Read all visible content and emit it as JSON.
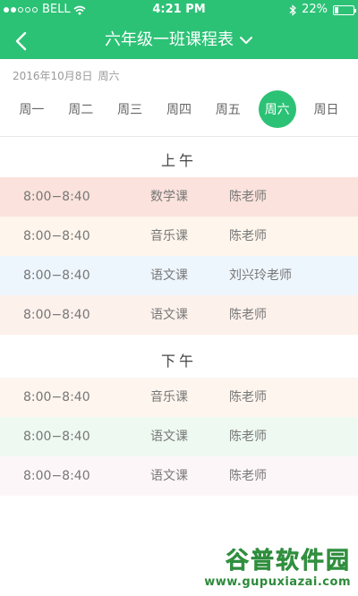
{
  "status": {
    "carrier": "BELL",
    "time": "4:21 PM",
    "battery": "22%",
    "battery_level": 0.22
  },
  "nav": {
    "title": "六年级一班课程表"
  },
  "date": {
    "date_text": "2016年10月8日",
    "weekday_text": "周六"
  },
  "week": {
    "days": [
      "周一",
      "周二",
      "周三",
      "周四",
      "周五",
      "周六",
      "周日"
    ],
    "selected": "周六"
  },
  "morning": {
    "title": "上午",
    "rows": [
      {
        "time": "8:00−8:40",
        "course": "数学课",
        "teacher": "陈老师",
        "bg": "#fbe2dc"
      },
      {
        "time": "8:00−8:40",
        "course": "音乐课",
        "teacher": "陈老师",
        "bg": "#fef5ec"
      },
      {
        "time": "8:00−8:40",
        "course": "语文课",
        "teacher": "刘兴玲老师",
        "bg": "#eef6fd"
      },
      {
        "time": "8:00−8:40",
        "course": "语文课",
        "teacher": "陈老师",
        "bg": "#fdf1ec"
      }
    ]
  },
  "afternoon": {
    "title": "下午",
    "rows": [
      {
        "time": "8:00−8:40",
        "course": "音乐课",
        "teacher": "陈老师",
        "bg": "#fdf5ee"
      },
      {
        "time": "8:00−8:40",
        "course": "语文课",
        "teacher": "陈老师",
        "bg": "#eef9f1"
      },
      {
        "time": "8:00−8:40",
        "course": "语文课",
        "teacher": "陈老师",
        "bg": "#fdf6f9"
      }
    ]
  },
  "watermark": {
    "brand": "谷普软件园",
    "url": "www.gupuxiazai.com"
  },
  "colors": {
    "accent": "#2cc276"
  }
}
